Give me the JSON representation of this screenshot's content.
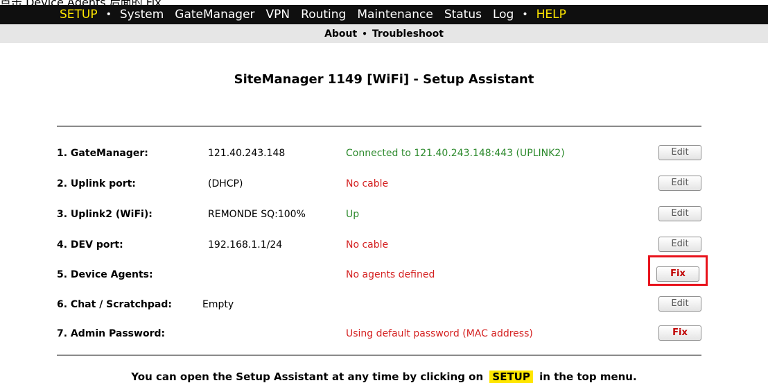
{
  "caption": "点击 Device Agents 后面的 Fix",
  "top_menu": {
    "setup": "SETUP",
    "system": "System",
    "gatemanager": "GateManager",
    "vpn": "VPN",
    "routing": "Routing",
    "maintenance": "Maintenance",
    "status": "Status",
    "log": "Log",
    "help": "HELP",
    "separator": "•"
  },
  "sub_menu": {
    "about": "About",
    "troubleshoot": "Troubleshoot",
    "separator": "•"
  },
  "title": "SiteManager 1149 [WiFi] - Setup Assistant",
  "rows": [
    {
      "label": "1. GateManager:",
      "value": "121.40.243.148",
      "status": "Connected to 121.40.243.148:443 (UPLINK2)",
      "button": "Edit"
    },
    {
      "label": "2. Uplink port:",
      "value": "(DHCP)",
      "status": "No cable",
      "button": "Edit"
    },
    {
      "label": "3. Uplink2 (WiFi):",
      "value": "REMONDE SQ:100%",
      "status": "Up",
      "button": "Edit"
    },
    {
      "label": "4. DEV port:",
      "value": "192.168.1.1/24",
      "status": "No cable",
      "button": "Edit"
    },
    {
      "label": "5. Device Agents:",
      "value": "",
      "status": "No agents defined",
      "button": "Fix"
    },
    {
      "label": "6. Chat / Scratchpad:",
      "value": "Empty",
      "status": "",
      "button": "Edit"
    },
    {
      "label": "7. Admin Password:",
      "value": "",
      "status": "Using default password (MAC address)",
      "button": "Fix"
    }
  ],
  "footer": {
    "before": "You can open the Setup Assistant at any time by clicking on",
    "chip": "SETUP",
    "after": "in the top menu."
  },
  "colors": {
    "menu_bar": "#0f0f0f",
    "menu_highlight": "#ffe600",
    "status_ok": "#2d8a2d",
    "status_error": "#d42020",
    "fix_text": "#c00000",
    "annotation_box": "#e8131c"
  }
}
